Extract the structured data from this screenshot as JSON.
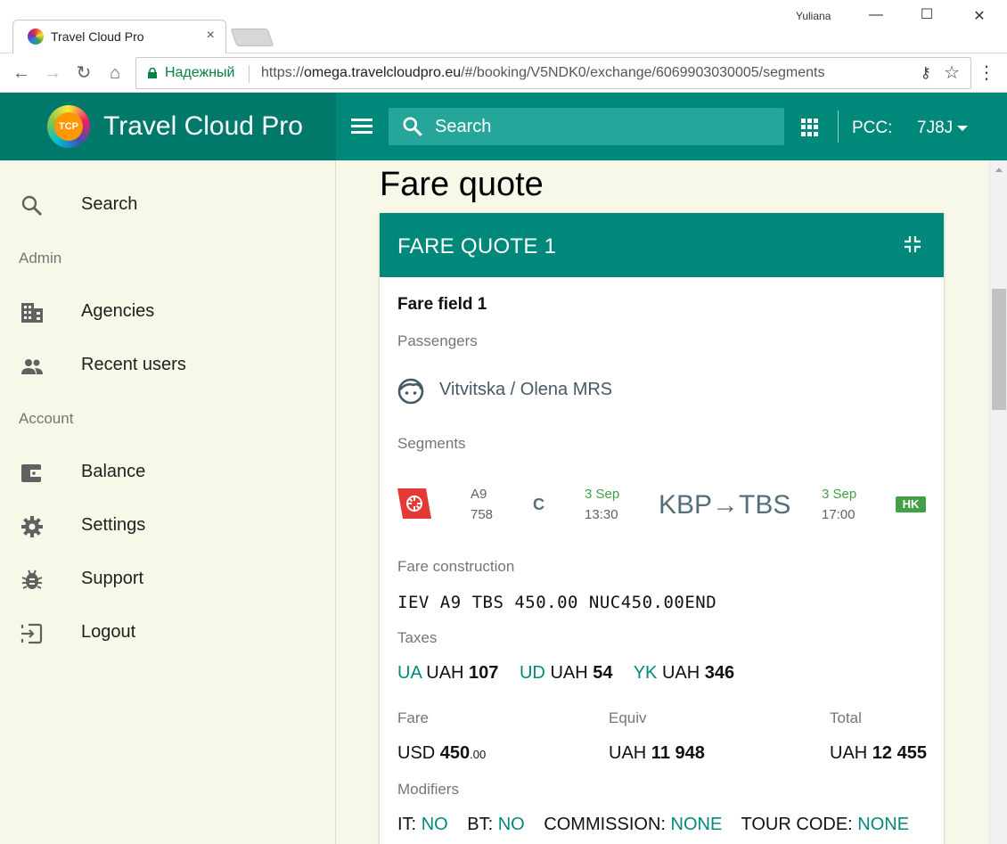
{
  "browser": {
    "tab_title": "Travel Cloud Pro",
    "tab_close": "×",
    "window_user": "Yuliana",
    "secure_label": "Надежный",
    "url_scheme": "https://",
    "url_host": "omega.travelcloudpro.eu",
    "url_path": "/#/booking/V5NDK0/exchange/6069903030005/segments"
  },
  "header": {
    "brand_name": "Travel Cloud Pro",
    "brand_logo_text": "TCP",
    "search_placeholder": "Search",
    "pcc_label": "PCC:",
    "pcc_value": "7J8J"
  },
  "sidebar": {
    "search": "Search",
    "admin_section": "Admin",
    "agencies": "Agencies",
    "recent_users": "Recent users",
    "account_section": "Account",
    "balance": "Balance",
    "settings": "Settings",
    "support": "Support",
    "logout": "Logout"
  },
  "page": {
    "title": "Fare quote"
  },
  "fare_quote": {
    "card_title": "FARE QUOTE 1",
    "field_title": "Fare field 1",
    "passengers_label": "Passengers",
    "passenger_name": "Vitvitska / Olena MRS",
    "segments_label": "Segments",
    "segment": {
      "airline": "A9",
      "flight": "758",
      "class": "C",
      "dep_date": "3 Sep",
      "dep_time": "13:30",
      "route": "KBP→TBS",
      "arr_date": "3 Sep",
      "arr_time": "17:00",
      "status": "HK"
    },
    "fare_construction_label": "Fare construction",
    "fare_construction": "IEV A9 TBS 450.00 NUC450.00END",
    "taxes_label": "Taxes",
    "taxes": [
      {
        "code": "UA",
        "currency": "UAH",
        "amount": "107"
      },
      {
        "code": "UD",
        "currency": "UAH",
        "amount": "54"
      },
      {
        "code": "YK",
        "currency": "UAH",
        "amount": "346"
      }
    ],
    "fare_label": "Fare",
    "fare_currency": "USD",
    "fare_amount": "450",
    "fare_decimals": ".00",
    "equiv_label": "Equiv",
    "equiv_currency": "UAH",
    "equiv_amount": "11 948",
    "total_label": "Total",
    "total_currency": "UAH",
    "total_amount": "12 455",
    "modifiers_label": "Modifiers",
    "modifiers": [
      {
        "name": "IT:",
        "value": "NO"
      },
      {
        "name": "BT:",
        "value": "NO"
      },
      {
        "name": "COMMISSION:",
        "value": "NONE"
      },
      {
        "name": "TOUR CODE:",
        "value": "NONE"
      }
    ]
  },
  "colors": {
    "primary": "#00897b",
    "primary_dark": "#00796b",
    "background": "#f8f8e8",
    "status_green": "#43a047",
    "airline_red": "#e53935"
  },
  "icons": {
    "nav_back": "arrow-left-icon",
    "nav_forward": "arrow-right-icon",
    "reload": "reload-icon",
    "home": "home-icon",
    "lock": "lock-icon",
    "key": "key-icon",
    "star": "star-icon",
    "menu": "vertical-dots-icon",
    "hamburger": "hamburger-icon",
    "search": "search-icon",
    "apps": "apps-grid-icon",
    "collapse": "collapse-icon",
    "passenger": "face-icon"
  }
}
